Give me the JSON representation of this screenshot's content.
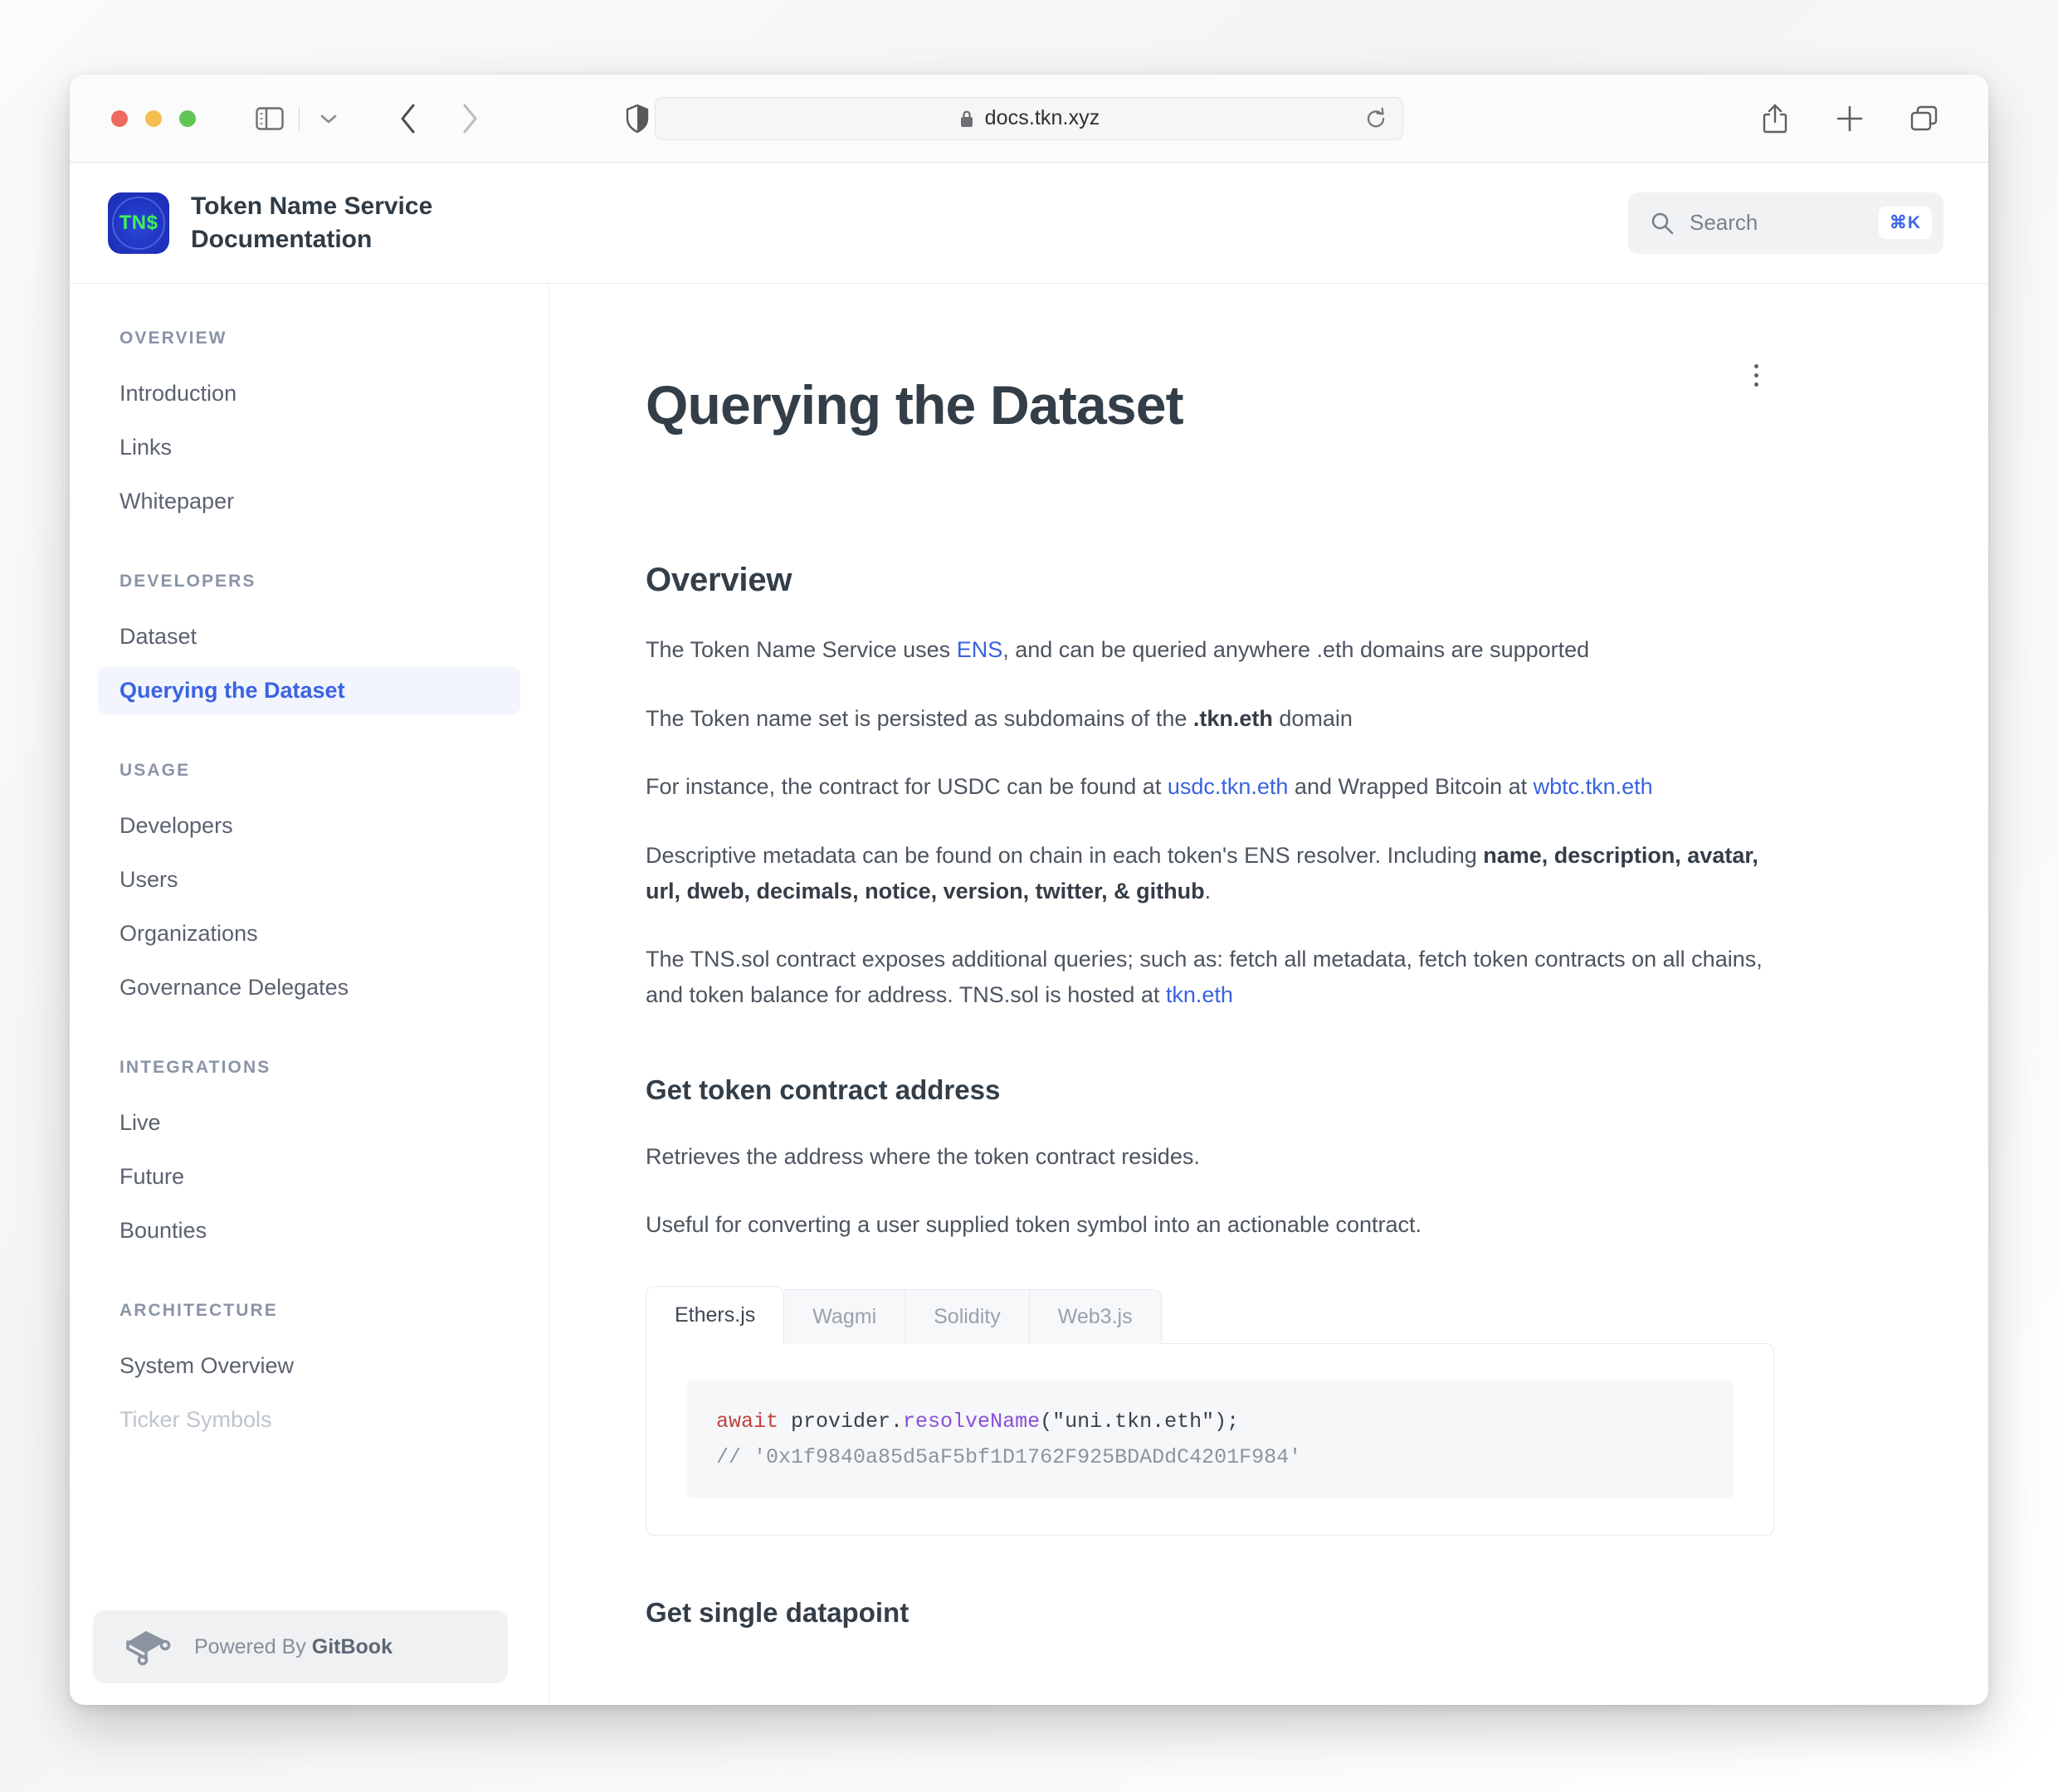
{
  "browser": {
    "url": "docs.tkn.xyz",
    "lock_icon": "lock-icon",
    "reload_icon": "reload-icon",
    "share_icon": "share-icon",
    "new_tab_icon": "plus-icon",
    "tab_overview_icon": "tab-overview-icon",
    "sidebar_toggle_icon": "sidebar-toggle-icon",
    "chevron_down_icon": "chevron-down-icon",
    "back_icon": "back-chevron-icon",
    "forward_icon": "forward-chevron-icon",
    "shield_icon": "privacy-shield-icon"
  },
  "site_header": {
    "logo_text": "TN$",
    "title": "Token Name Service Documentation",
    "accent_blue": "#3a63e0",
    "logo_bg": "#1f33bf",
    "logo_fg": "#3ef05a"
  },
  "search": {
    "placeholder": "Search",
    "shortcut": "⌘K",
    "icon": "search-icon"
  },
  "sidebar": {
    "groups": [
      {
        "title": "OVERVIEW",
        "items": [
          {
            "label": "Introduction",
            "active": false
          },
          {
            "label": "Links",
            "active": false
          },
          {
            "label": "Whitepaper",
            "active": false
          }
        ]
      },
      {
        "title": "DEVELOPERS",
        "items": [
          {
            "label": "Dataset",
            "active": false
          },
          {
            "label": "Querying the Dataset",
            "active": true
          }
        ]
      },
      {
        "title": "USAGE",
        "items": [
          {
            "label": "Developers",
            "active": false
          },
          {
            "label": "Users",
            "active": false
          },
          {
            "label": "Organizations",
            "active": false
          },
          {
            "label": "Governance Delegates",
            "active": false
          }
        ]
      },
      {
        "title": "INTEGRATIONS",
        "items": [
          {
            "label": "Live",
            "active": false
          },
          {
            "label": "Future",
            "active": false
          },
          {
            "label": "Bounties",
            "active": false
          }
        ]
      },
      {
        "title": "ARCHITECTURE",
        "items": [
          {
            "label": "System Overview",
            "active": false
          },
          {
            "label": "Ticker Symbols",
            "active": false,
            "faded": true
          }
        ]
      }
    ],
    "footer": {
      "prefix": "Powered By ",
      "brand": "GitBook",
      "icon": "gitbook-logo-icon"
    }
  },
  "page": {
    "title": "Querying the Dataset",
    "menu_icon": "kebab-menu-icon",
    "overview_heading": "Overview",
    "p1_a": "The Token Name Service uses ",
    "p1_link": "ENS",
    "p1_b": ", and can be queried anywhere .eth domains are supported",
    "p2_a": "The Token name set is persisted as subdomains of the ",
    "p2_bold": ".tkn.eth",
    "p2_b": " domain",
    "p3_a": "For instance, the contract for USDC can be found at ",
    "p3_link1": "usdc.tkn.eth",
    "p3_b": " and Wrapped Bitcoin at ",
    "p3_link2": "wbtc.tkn.eth",
    "p4_a": "Descriptive metadata can be found on chain in each token's ENS resolver. Including ",
    "p4_bold": "name, description, avatar, url, dweb, decimals, notice, version, twitter, & github",
    "p4_b": ".",
    "p5_a": "The TNS.sol contract exposes additional queries; such as: fetch all metadata, fetch token contracts on all chains, and token balance for address. TNS.sol is hosted at ",
    "p5_link": "tkn.eth",
    "section1_heading": "Get token contract address",
    "section1_p1": "Retrieves the address where the token contract resides.",
    "section1_p2": "Useful for converting a user supplied token symbol into an actionable contract.",
    "section2_heading": "Get single datapoint"
  },
  "code_tabs": {
    "tabs": [
      {
        "label": "Ethers.js",
        "active": true
      },
      {
        "label": "Wagmi",
        "active": false
      },
      {
        "label": "Solidity",
        "active": false
      },
      {
        "label": "Web3.js",
        "active": false
      }
    ],
    "snippet": {
      "keyword": "await",
      "object": " provider.",
      "method": "resolveName",
      "args": "(\"uni.tkn.eth\");",
      "comment": "// '0x1f9840a85d5aF5bf1D1762F925BDADdC4201F984'"
    }
  }
}
